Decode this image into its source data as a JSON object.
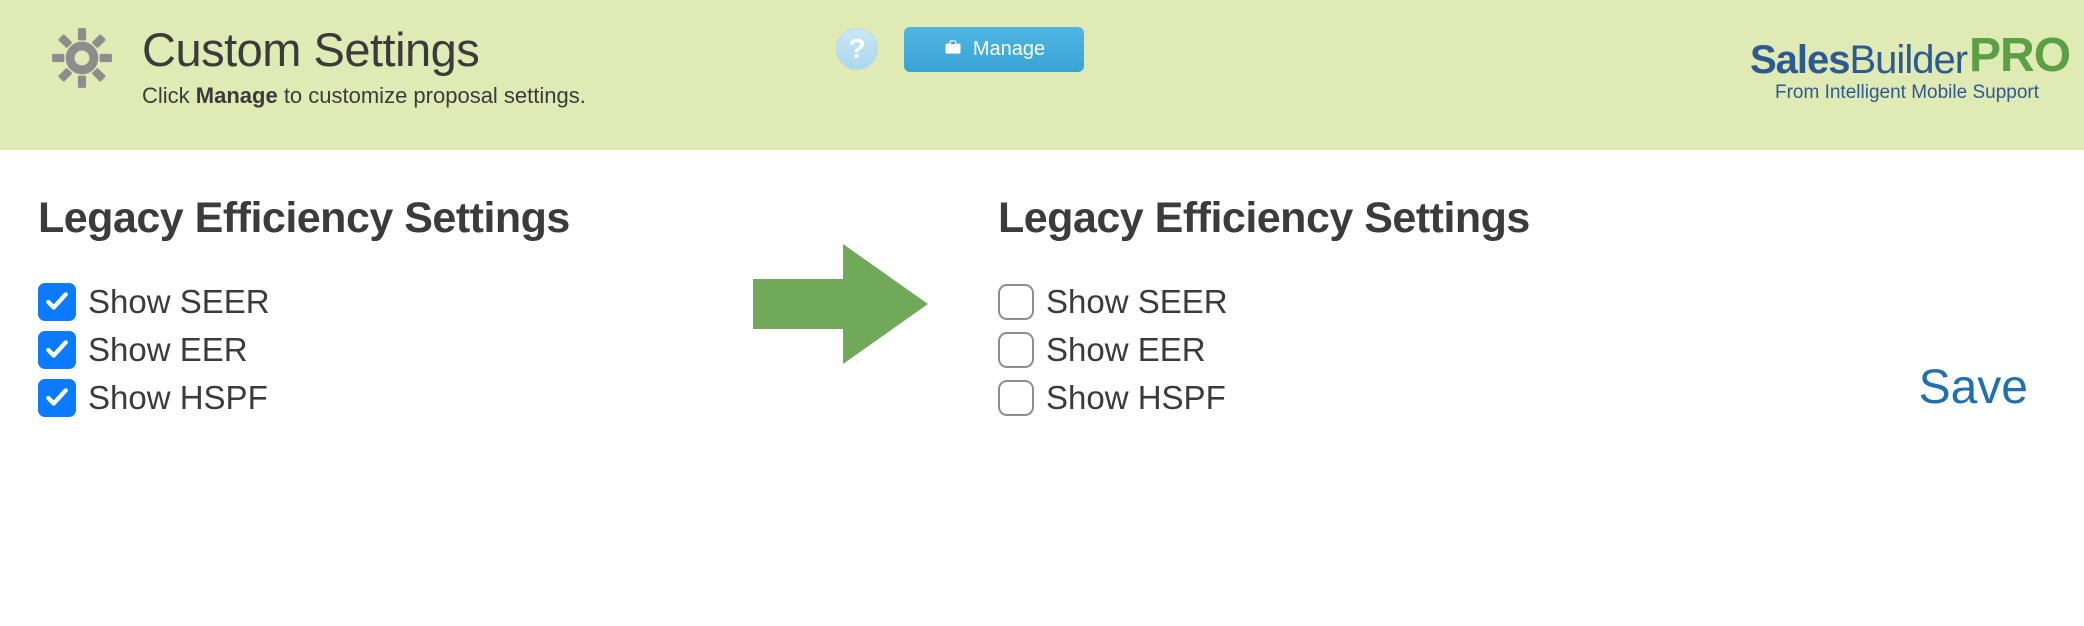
{
  "header": {
    "title": "Custom Settings",
    "subtitle_pre": "Click ",
    "subtitle_bold": "Manage",
    "subtitle_post": " to customize proposal settings.",
    "manage_label": "Manage"
  },
  "logo": {
    "brand_a": "Sales",
    "brand_b": "Builder",
    "brand_pro": "PRO",
    "sub": "From Intelligent Mobile Support"
  },
  "left": {
    "title": "Legacy Efficiency Settings",
    "options": [
      "Show SEER",
      "Show EER",
      "Show HSPF"
    ]
  },
  "right": {
    "title": "Legacy Efficiency Settings",
    "options": [
      "Show SEER",
      "Show EER",
      "Show HSPF"
    ]
  },
  "save_label": "Save"
}
